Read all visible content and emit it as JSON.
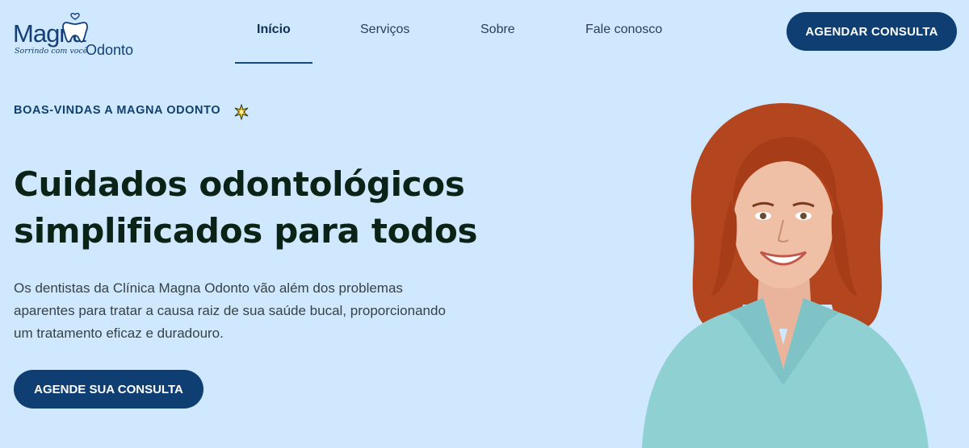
{
  "brand": {
    "logo_main": "Magna",
    "logo_sub": "Odonto",
    "tagline": "Sorrindo com você"
  },
  "nav": {
    "items": [
      {
        "label": "Início",
        "active": true
      },
      {
        "label": "Serviços",
        "active": false
      },
      {
        "label": "Sobre",
        "active": false
      },
      {
        "label": "Fale conosco",
        "active": false
      }
    ]
  },
  "header": {
    "cta_label": "AGENDAR CONSULTA"
  },
  "hero": {
    "eyebrow": "BOAS-VINDAS A MAGNA ODONTO",
    "eyebrow_icon": "sparkle-icon",
    "title": "Cuidados odontológicos simplificados para todos",
    "description": "Os dentistas da Clínica Magna Odonto vão além dos problemas aparentes para tratar a causa raiz de sua saúde bucal, proporcionando um tratamento eficaz e duradouro.",
    "cta_label": "AGENDE SUA CONSULTA"
  },
  "colors": {
    "background": "#cfe8fd",
    "primary": "#0e3e72",
    "heading": "#0a2316",
    "scrubs": "#8fd0d3",
    "hair": "#b4461f"
  }
}
